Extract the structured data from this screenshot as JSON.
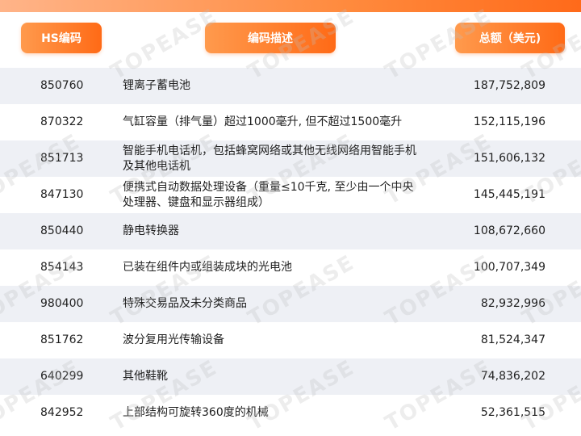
{
  "header": {
    "hs_code_label": "HS编码",
    "description_label": "编码描述",
    "total_label": "总额（美元)"
  },
  "rows": [
    {
      "code": "850760",
      "desc_lines": [
        "锂离子蓄电池"
      ],
      "total": "187,752,809"
    },
    {
      "code": "870322",
      "desc_lines": [
        "气缸容量（排气量）超过1000毫升, 但不超过1500毫升"
      ],
      "total": "152,115,196"
    },
    {
      "code": "851713",
      "desc_lines": [
        "智能手机电话机，包括蜂窝网络或其他无线网络用智能手机",
        "及其他电话机"
      ],
      "total": "151,606,132"
    },
    {
      "code": "847130",
      "desc_lines": [
        "便携式自动数据处理设备（重量≤10千克, 至少由一个中央",
        "处理器、键盘和显示器组成）"
      ],
      "total": "145,445,191"
    },
    {
      "code": "850440",
      "desc_lines": [
        "静电转换器"
      ],
      "total": "108,672,660"
    },
    {
      "code": "854143",
      "desc_lines": [
        "已装在组件内或组装成块的光电池"
      ],
      "total": "100,707,349"
    },
    {
      "code": "980400",
      "desc_lines": [
        "特殊交易品及未分类商品"
      ],
      "total": "82,932,996"
    },
    {
      "code": "851762",
      "desc_lines": [
        "波分复用光传输设备"
      ],
      "total": "81,524,347"
    },
    {
      "code": "640299",
      "desc_lines": [
        "其他鞋靴"
      ],
      "total": "74,836,202"
    },
    {
      "code": "842952",
      "desc_lines": [
        "上部结构可旋转360度的机械"
      ],
      "total": "52,361,515"
    }
  ],
  "watermark_text": "TOPEASE",
  "colors": {
    "accent": "#ff6a16",
    "accent_light": "#ff9a4d",
    "row_stripe": "#eef0f5"
  }
}
